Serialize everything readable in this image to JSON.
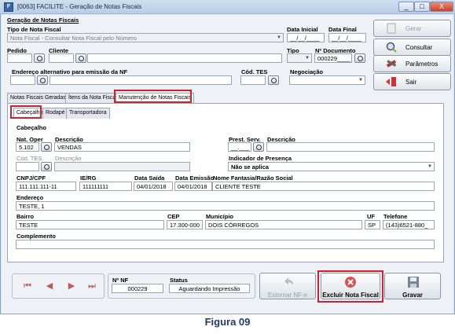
{
  "window": {
    "title": "[0063] FACILITE - Geração de Notas Fiscais",
    "controls": [
      "_",
      "□",
      "X"
    ]
  },
  "header": {
    "section": "Geração de Notas Fiscais",
    "tipo_nota_label": "Tipo de Nota Fiscal",
    "tipo_nota_value": "Nota Fiscal - Consultar Nota Fiscal pelo Número",
    "data_inicial_label": "Data Inicial",
    "data_inicial_value": "__/__/____",
    "data_final_label": "Data Final",
    "data_final_value": "__/__/____",
    "pedido_label": "Pedido",
    "cliente_label": "Cliente",
    "tipo_label": "Tipo",
    "num_doc_label": "Nº Documento",
    "num_doc_value": "000229____",
    "endereco_label": "Endereço alternativo para emissão da NF",
    "cod_tes_label": "Cód. TES",
    "negociacao_label": "Negociação"
  },
  "side_buttons": {
    "gerar": "Gerar",
    "consultar": "Consultar",
    "parametros": "Parâmetros",
    "sair": "Sair"
  },
  "tabs": [
    "Notas Fiscais Geradas",
    "Ítens da Nota Fiscal",
    "Manutenção de Notas Fiscais"
  ],
  "subtabs": [
    "Cabeçalho",
    "Rodapé",
    "Transportadora"
  ],
  "cabecalho": {
    "group": "Cabeçalho",
    "nat_oper_label": "Nat. Oper",
    "nat_oper_value": "5.102",
    "descricao_label": "Descrição",
    "descricao_value": "VENDAS",
    "prest_serv_label": "Prest. Serv.",
    "prest_serv_value": "__.___",
    "descricao2_label": "Descrição",
    "cod_tes_label": "Cód. TES",
    "descricao3_label": "Descrição",
    "indicador_label": "Indicador de Presença",
    "indicador_value": "Não se aplica",
    "cnpj_label": "CNPJ/CPF",
    "cnpj_value": "111.111.111-11",
    "ie_label": "IE/RG",
    "ie_value": "111111111",
    "data_saida_label": "Data Saída",
    "data_saida_value": "04/01/2018",
    "data_emissao_label": "Data Emissão",
    "data_emissao_value": "04/01/2018",
    "nome_label": "Nome Fantasia/Razão Social",
    "nome_value": "CLIENTE TESTE",
    "endereco_label": "Endereço",
    "endereco_value": "TESTE, 1",
    "bairro_label": "Bairro",
    "bairro_value": "TESTE",
    "cep_label": "CEP",
    "cep_value": "17.300-000",
    "municipio_label": "Município",
    "municipio_value": "DOIS CÓRREGOS",
    "uf_label": "UF",
    "uf_value": "SP",
    "telefone_label": "Telefone",
    "telefone_value": "(143)6521-880_",
    "complemento_label": "Complemento"
  },
  "footer": {
    "nnf_label": "Nº NF",
    "nnf_value": "000229",
    "status_label": "Status",
    "status_value": "Aguardando Impressão",
    "estornar": "Estornar NF-e",
    "excluir": "Excluir Nota Fiscal",
    "gravar": "Gravar"
  },
  "caption": "Figura 09"
}
